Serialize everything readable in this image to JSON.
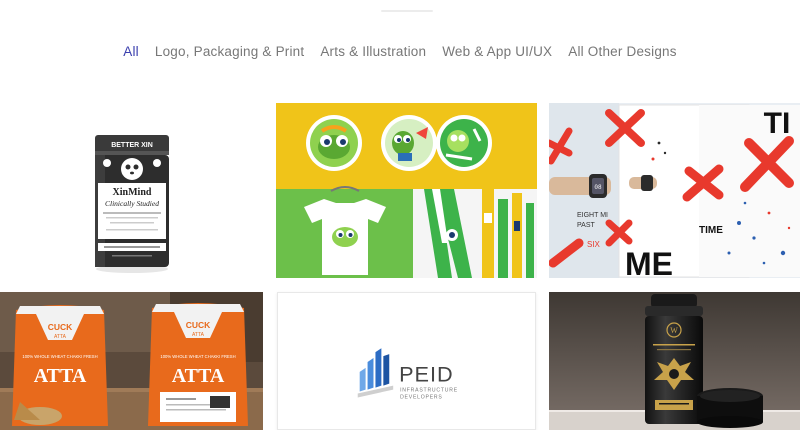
{
  "filters": [
    {
      "label": "All",
      "active": true
    },
    {
      "label": "Logo, Packaging & Print",
      "active": false
    },
    {
      "label": "Arts & Illustration",
      "active": false
    },
    {
      "label": "Web & App UI/UX",
      "active": false
    },
    {
      "label": "All Other Designs",
      "active": false
    }
  ],
  "accent_color": "#3b3fae",
  "tiles": {
    "t1": {
      "brand": "BETTER XIN",
      "product": "XinMind",
      "tagline": "Clinically Studied"
    },
    "t3": {
      "big_ti": "TI",
      "big_me": "ME",
      "small_time": "TIME",
      "eight": "EIGHT MI",
      "past": "PAST",
      "six": "SIX",
      "watch_time": "08"
    },
    "t4": {
      "brand": "CUCK",
      "sub": "ATTA",
      "atta": "ATTA",
      "desc": "100% WHOLE WHEAT CHAKKI FRESH"
    },
    "t5": {
      "logo_name": "PEID",
      "logo_sub1": "INFRASTRUCTURE",
      "logo_sub2": "DEVELOPERS"
    },
    "t6": {
      "brand_letter": "W"
    }
  }
}
